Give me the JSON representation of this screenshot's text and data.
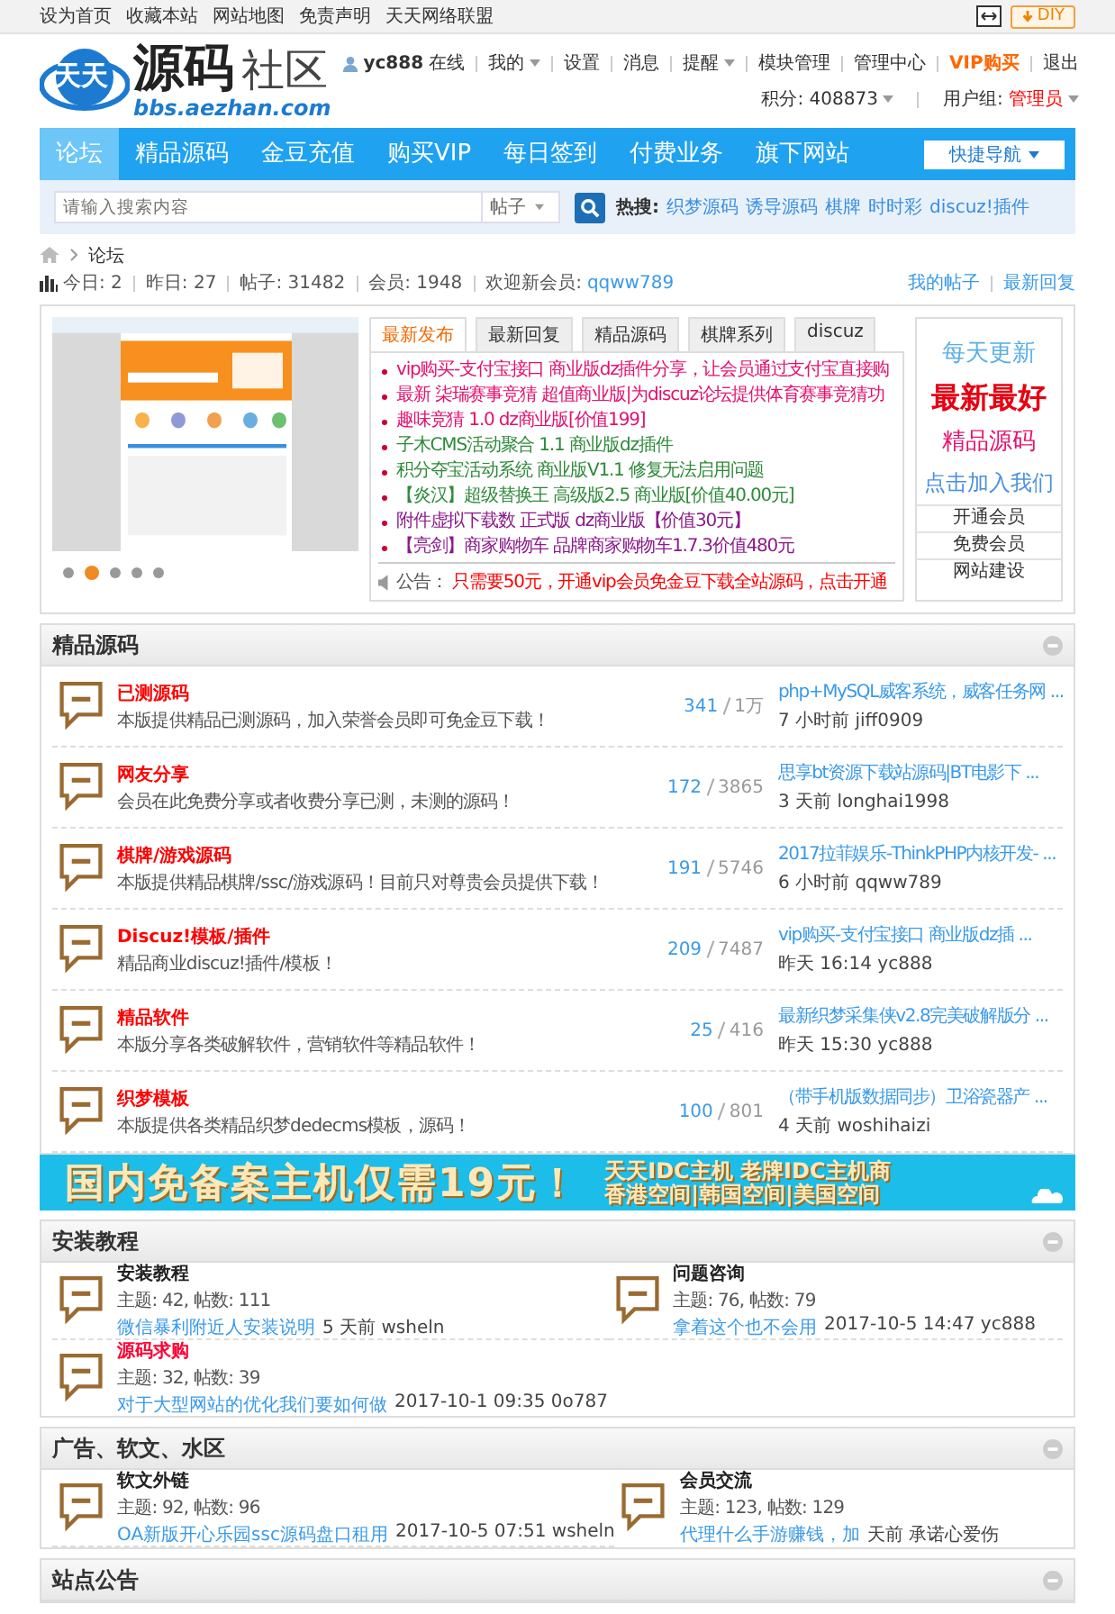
{
  "topbar": {
    "links": [
      "设为首页",
      "收藏本站",
      "网站地图",
      "免责声明",
      "天天网络联盟"
    ],
    "diy": "DIY"
  },
  "logo": {
    "badge": "天天",
    "title": "源码",
    "title2": "社区",
    "url": "bbs.aezhan.com"
  },
  "user": {
    "name": "yc888",
    "status": "在线",
    "menu": [
      {
        "label": "我的",
        "dropdown": true,
        "highlight": false
      },
      {
        "label": "设置",
        "dropdown": false,
        "highlight": false
      },
      {
        "label": "消息",
        "dropdown": false,
        "highlight": false
      },
      {
        "label": "提醒",
        "dropdown": true,
        "highlight": false
      },
      {
        "label": "模块管理",
        "dropdown": false,
        "highlight": false
      },
      {
        "label": "管理中心",
        "dropdown": false,
        "highlight": false
      },
      {
        "label": "VIP购买",
        "dropdown": false,
        "highlight": true
      },
      {
        "label": "退出",
        "dropdown": false,
        "highlight": false
      }
    ],
    "points": "积分: 408873",
    "group_label": "用户组:",
    "group": "管理员"
  },
  "nav": {
    "items": [
      {
        "label": "论坛",
        "selected": true
      },
      {
        "label": "精品源码",
        "selected": false
      },
      {
        "label": "金豆充值",
        "selected": false
      },
      {
        "label": "购买VIP",
        "selected": false
      },
      {
        "label": "每日签到",
        "selected": false
      },
      {
        "label": "付费业务",
        "selected": false
      },
      {
        "label": "旗下网站",
        "selected": false
      }
    ],
    "quick": "快捷导航"
  },
  "search": {
    "placeholder": "请输入搜索内容",
    "type": "帖子",
    "hot_label": "热搜:",
    "hot": [
      "织梦源码",
      "诱导源码",
      "棋牌",
      "时时彩",
      "discuz!插件"
    ]
  },
  "breadcrumb": "论坛",
  "stats": {
    "items": [
      "今日: 2",
      "昨日: 27",
      "帖子: 31482",
      "会员: 1948"
    ],
    "new_label": "欢迎新会员:",
    "new_member": "qqww789",
    "links": [
      "我的帖子",
      "最新回复"
    ]
  },
  "slider": {
    "dots": [
      {
        "selected": false
      },
      {
        "selected": true
      },
      {
        "selected": false
      },
      {
        "selected": false
      },
      {
        "selected": false
      }
    ]
  },
  "tabs": [
    {
      "label": "最新发布",
      "selected": true
    },
    {
      "label": "最新回复",
      "selected": false
    },
    {
      "label": "精品源码",
      "selected": false
    },
    {
      "label": "棋牌系列",
      "selected": false
    },
    {
      "label": "discuz",
      "selected": false
    }
  ],
  "posts": [
    {
      "text": "vip购买-支付宝接口 商业版dz插件分享，让会员通过支付宝直接购",
      "color": "#e4106e"
    },
    {
      "text": "最新 柒瑞赛事竞猜 超值商业版|为discuz论坛提供体育赛事竞猜功",
      "color": "#e4106e"
    },
    {
      "text": "趣味竞猜 1.0 dz商业版[价值199]",
      "color": "#e4106e"
    },
    {
      "text": "子木CMS活动聚合 1.1 商业版dz插件",
      "color": "#2e8b3a"
    },
    {
      "text": "积分夺宝活动系统 商业版V1.1 修复无法启用问题",
      "color": "#2e8b3a"
    },
    {
      "text": "【炎汉】超级替换王 高级版2.5 商业版[价值40.00元]",
      "color": "#2e8b3a"
    },
    {
      "text": "附件虚拟下载数 正式版 dz商业版【价值30元】",
      "color": "#8b1a8b"
    },
    {
      "text": "【亮剑】商家购物车 品牌商家购物车1.7.3价值480元",
      "color": "#8b1a8b"
    }
  ],
  "notice": {
    "label": "公告：",
    "text": "只需要50元，开通vip会员免金豆下载全站源码，点击开通"
  },
  "promo": {
    "lines": [
      {
        "text": "每天更新",
        "color": "#5aaee8"
      },
      {
        "text": "最新最好",
        "color": "#e60012"
      },
      {
        "text": "精品源码",
        "color": "#e4106e"
      },
      {
        "text": "点击加入我们",
        "color": "#4a90e2"
      }
    ],
    "links": [
      "开通会员",
      "免费会员",
      "网站建设"
    ]
  },
  "sections": [
    {
      "kind": "list",
      "title": "精品源码",
      "forums": [
        {
          "name": "已测源码",
          "color": "#ff0000",
          "desc": "本版提供精品已测源码，加入荣誉会员即可免金豆下载！",
          "threads": "341",
          "posts": "1万",
          "last_title": "php+MySQL威客系统，威客任务网 ...",
          "last_meta": "7 小时前 jiff0909"
        },
        {
          "name": "网友分享",
          "color": "#ff0000",
          "desc": "会员在此免费分享或者收费分享已测，未测的源码！",
          "threads": "172",
          "posts": "3865",
          "last_title": "思享bt资源下载站源码|BT电影下 ...",
          "last_meta": "3 天前 longhai1998"
        },
        {
          "name": "棋牌/游戏源码",
          "color": "#ff0000",
          "desc": "本版提供精品棋牌/ssc/游戏源码！目前只对尊贵会员提供下载！",
          "threads": "191",
          "posts": "5746",
          "last_title": "2017拉菲娱乐-ThinkPHP内核开发- ...",
          "last_meta": "6 小时前 qqww789"
        },
        {
          "name": "Discuz!模板/插件",
          "color": "#ff0000",
          "desc": "精品商业discuz!插件/模板！",
          "threads": "209",
          "posts": "7487",
          "last_title": "vip购买-支付宝接口 商业版dz插 ...",
          "last_meta": "昨天 16:14 yc888"
        },
        {
          "name": "精品软件",
          "color": "#ff0000",
          "desc": "本版分享各类破解软件，营销软件等精品软件！",
          "threads": "25",
          "posts": "416",
          "last_title": "最新织梦采集侠v2.8完美破解版分 ...",
          "last_meta": "昨天 15:30 yc888"
        },
        {
          "name": "织梦模板",
          "color": "#ff0000",
          "desc": "本版提供各类精品织梦dedecms模板，源码！",
          "threads": "100",
          "posts": "801",
          "last_title": "（带手机版数据同步）卫浴瓷器产 ...",
          "last_meta": "4 天前 woshihaizi"
        }
      ]
    },
    {
      "kind": "ad",
      "headline": "国内免备案主机仅需19元！",
      "line1": "天天IDC主机 老牌IDC主机商",
      "line2": "香港空间|韩国空间|美国空间"
    },
    {
      "kind": "grid",
      "title": "安装教程",
      "forums": [
        {
          "name": "安装教程",
          "color": "#222222",
          "stats": "主题: 42, 帖数: 111",
          "last_title": "微信暴利附近人安装说明",
          "last_meta": "5 天前 wsheln"
        },
        {
          "name": "问题咨询",
          "color": "#222222",
          "stats": "主题: 76, 帖数: 79",
          "last_title": "拿着这个也不会用",
          "last_meta": "2017-10-5 14:47 yc888"
        },
        {
          "name": "源码求购",
          "color": "#ff0033",
          "stats": "主题: 32, 帖数: 39",
          "last_title": "对于大型网站的优化我们要如何做",
          "last_meta": "2017-10-1 09:35 0o787"
        }
      ]
    },
    {
      "kind": "grid",
      "title": "广告、软文、水区",
      "forums": [
        {
          "name": "软文外链",
          "color": "#222222",
          "stats": "主题: 92, 帖数: 96",
          "last_title": "OA新版开心乐园ssc源码盘口租用",
          "last_meta": "2017-10-5 07:51 wsheln"
        },
        {
          "name": "会员交流",
          "color": "#222222",
          "stats": "主题: 123, 帖数: 129",
          "last_title": "代理什么手游赚钱，加",
          "last_meta": "天前 承诺心爱伤"
        }
      ]
    },
    {
      "kind": "grid",
      "title": "站点公告"
    }
  ]
}
